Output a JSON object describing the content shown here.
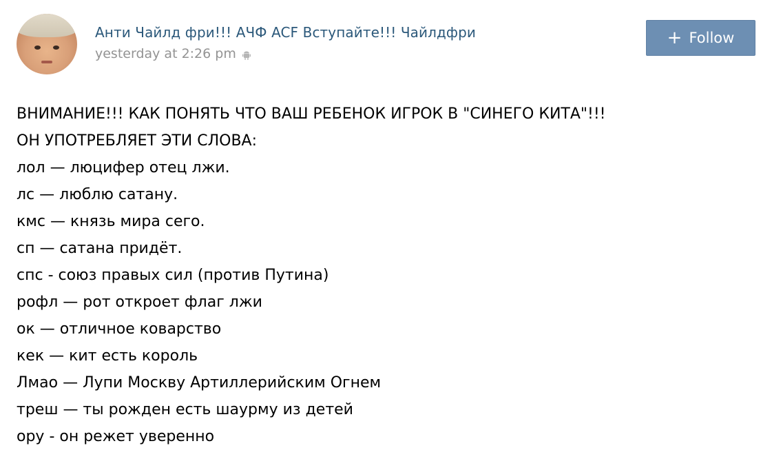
{
  "post": {
    "author": "Анти Чайлд фри!!! АЧФ ACF Вступайте!!! Чайлдфри",
    "timestamp": "yesterday at 2:26 pm",
    "platform_icon": "android-icon",
    "follow_button": {
      "plus": "+",
      "label": "Follow"
    },
    "lines": [
      "ВНИМАНИЕ!!! КАК ПОНЯТЬ ЧТО ВАШ РЕБЕНОК ИГРОК В \"СИНЕГО КИТА\"!!!",
      "ОН УПОТРЕБЛЯЕТ ЭТИ СЛОВА:",
      "лол — люцифер отец лжи.",
      "лс — люблю сатану.",
      "кмс — князь мира сего.",
      "сп — сатана придёт.",
      "спс - союз правых сил (против Путина)",
      "рофл — рот откроет флаг лжи",
      "ок — отличное коварство",
      "кек — кит есть король",
      "Лмао — Лупи Москву Артиллерийским Огнем",
      "треш — ты рожден есть шаурму из детей",
      "ору - он режет уверенно"
    ]
  },
  "colors": {
    "author_link": "#2b587a",
    "meta_text": "#939393",
    "follow_button_bg": "#6d8fb3",
    "text": "#000000"
  }
}
